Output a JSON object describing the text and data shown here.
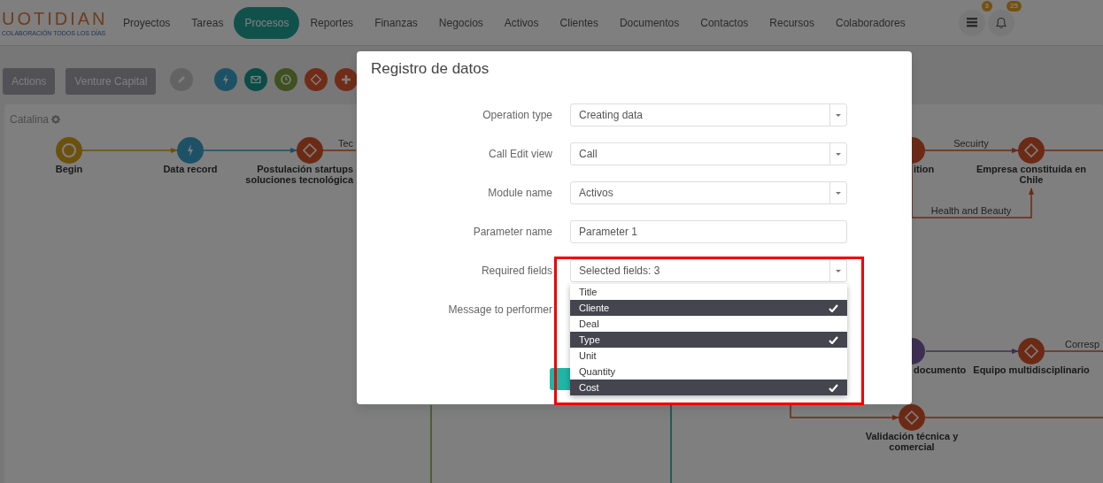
{
  "navbar": {
    "logo": "UOTIDIAN",
    "tagline": "COLABORACIÓN TODOS LOS DÍAS",
    "items": [
      {
        "label": "Proyectos",
        "selected": false
      },
      {
        "label": "Tareas",
        "selected": false
      },
      {
        "label": "Procesos",
        "selected": true
      },
      {
        "label": "Reportes",
        "selected": false
      },
      {
        "label": "Finanzas",
        "selected": false
      },
      {
        "label": "Negocios",
        "selected": false
      },
      {
        "label": "Activos",
        "selected": false
      },
      {
        "label": "Clientes",
        "selected": false
      },
      {
        "label": "Documentos",
        "selected": false
      },
      {
        "label": "Contactos",
        "selected": false
      },
      {
        "label": "Recursos",
        "selected": false
      },
      {
        "label": "Colaboradores",
        "selected": false
      }
    ],
    "icons": [
      {
        "kind": "list",
        "badge": "3"
      },
      {
        "kind": "bell",
        "badge": "25"
      }
    ]
  },
  "toolbar": {
    "buttons": [
      "Actions",
      "Venture Capital"
    ],
    "tools": [
      {
        "kind": "pencil"
      },
      {
        "kind": "lightning"
      },
      {
        "kind": "envelope"
      },
      {
        "kind": "clock"
      },
      {
        "kind": "diamond"
      },
      {
        "kind": "plus"
      }
    ]
  },
  "canvas": {
    "title": "Catalina",
    "nodes": [
      {
        "kind": "start",
        "label": [
          "Begin"
        ]
      },
      {
        "kind": "action",
        "label": [
          "Data record"
        ]
      },
      {
        "kind": "gateway",
        "label": [
          "Postulación startups",
          "soluciones tecnológica"
        ]
      },
      {
        "kind": "gateway",
        "label": [
          "ition"
        ]
      },
      {
        "kind": "gateway",
        "label": [
          "Empresa constituida en",
          "Chile"
        ]
      },
      {
        "kind": "document",
        "label": [
          "documento"
        ]
      },
      {
        "kind": "gateway",
        "label": [
          "Equipo multidisciplinario"
        ]
      },
      {
        "kind": "gateway",
        "label": [
          "Validación técnica y",
          "comercial"
        ]
      }
    ],
    "edge_labels": [
      "Tec",
      "Secuirty",
      "Health and Beauty",
      "Corresp"
    ]
  },
  "modal": {
    "title": "Registro de datos",
    "fields": [
      {
        "label": "Operation type",
        "kind": "select",
        "value": "Creating data"
      },
      {
        "label": "Call Edit view",
        "kind": "select",
        "value": "Call"
      },
      {
        "label": "Module name",
        "kind": "select",
        "value": "Activos"
      },
      {
        "label": "Parameter name",
        "kind": "text",
        "value": "Parameter 1"
      },
      {
        "label": "Required fields",
        "kind": "multiselect",
        "value": "Selected fields: 3",
        "expanded": true,
        "options": [
          {
            "label": "Title",
            "selected": false
          },
          {
            "label": "Cliente",
            "selected": true
          },
          {
            "label": "Deal",
            "selected": false
          },
          {
            "label": "Type",
            "selected": true
          },
          {
            "label": "Unit",
            "selected": false
          },
          {
            "label": "Quantity",
            "selected": false
          },
          {
            "label": "Cost",
            "selected": true
          }
        ]
      },
      {
        "label": "Message to performer",
        "kind": "covered"
      }
    ]
  }
}
